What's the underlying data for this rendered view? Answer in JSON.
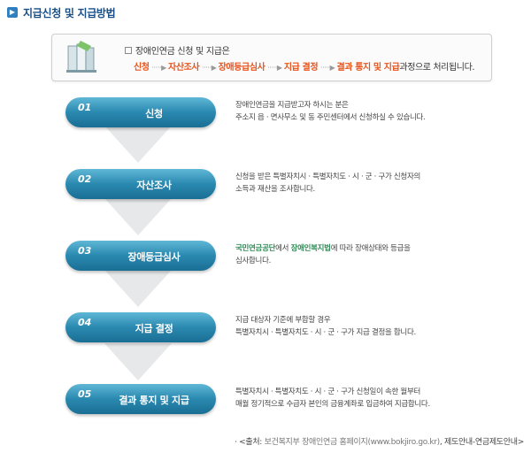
{
  "header": {
    "title": "지급신청 및 지급방법"
  },
  "summary": {
    "intro": "장애인연금 신청 및 지급은",
    "flow": [
      "신청",
      "자산조사",
      "장애등급심사",
      "지급 결정",
      "결과 통지 및 지급"
    ],
    "suffix": "과정으로 처리됩니다."
  },
  "steps": [
    {
      "num": "01",
      "name": "신청",
      "desc": [
        "장애인연금을 지급받고자 하시는 분은",
        "주소지 읍 ·  면사무소 및 동 주민센터에서 신청하실 수 있습니다."
      ]
    },
    {
      "num": "02",
      "name": "자산조사",
      "desc": [
        "신청을 받은 특별자치시 · 특별자치도 · 시 · 군 · 구가 신청자의",
        "소득과 재산을 조사합니다."
      ]
    },
    {
      "num": "03",
      "name": "장애등급심사",
      "desc_hl1": "국민연금공단",
      "desc_mid1": "에서 ",
      "desc_hl2": "장애인복지법",
      "desc_rest1": "에 따라 장애상태와 등급을",
      "desc_line2": "심사합니다."
    },
    {
      "num": "04",
      "name": "지급 결정",
      "desc": [
        "지급 대상자 기준에 부합할 경우",
        "특별자치시 · 특별자치도 · 시 · 군 · 구가 지급 결정을 합니다."
      ]
    },
    {
      "num": "05",
      "name": "결과 통지 및 지급",
      "desc": [
        "특별자치시 · 특별자치도 · 시 · 군 · 구가 신청일이 속한 월부터",
        "매월 정기적으로 수급자 본인의 금융계좌로 입금하여 지급합니다."
      ]
    }
  ],
  "source": {
    "prefix": "· <출처: ",
    "site": "보건복지부 장애인연금 홈페이지(www.bokjiro.go.kr)",
    "path": ", 제도안내-연금제도안내>"
  },
  "colors": {
    "accent": "#e8541d",
    "pill": "#2a89b0",
    "green": "#2e8b57",
    "title": "#1a4f86"
  }
}
